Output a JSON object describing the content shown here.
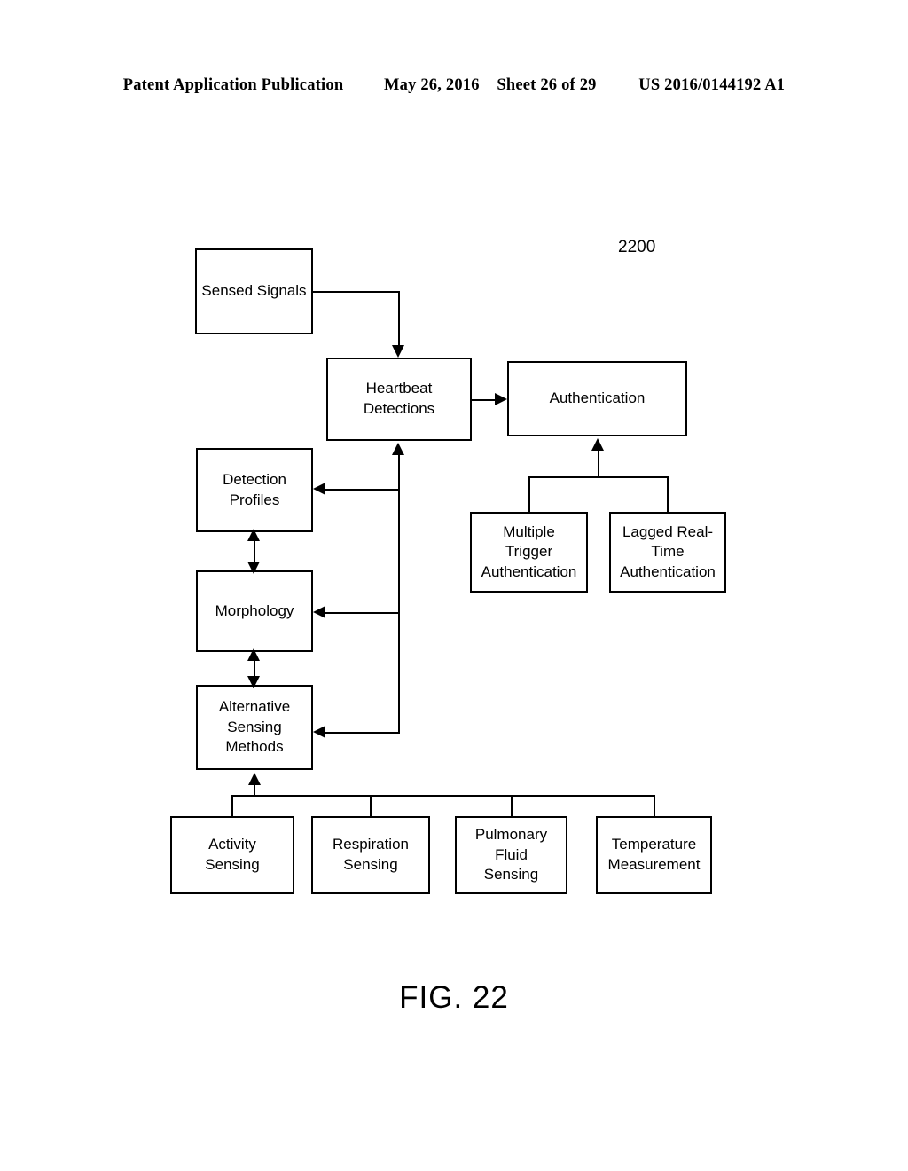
{
  "header": {
    "publication": "Patent Application Publication",
    "date": "May 26, 2016",
    "sheet": "Sheet 26 of 29",
    "patent_number": "US 2016/0144192 A1"
  },
  "figure": {
    "caption": "FIG. 22",
    "reference_numeral": "2200"
  },
  "diagram": {
    "nodes": {
      "sensed_signals": "Sensed Signals",
      "heartbeat_detections": "Heartbeat\nDetections",
      "authentication": "Authentication",
      "multiple_trigger_authentication": "Multiple\nTrigger\nAuthentication",
      "lagged_real_time_authentication": "Lagged Real-\nTime\nAuthentication",
      "detection_profiles": "Detection\nProfiles",
      "morphology": "Morphology",
      "alternative_sensing_methods": "Alternative\nSensing\nMethods",
      "activity_sensing": "Activity\nSensing",
      "respiration_sensing": "Respiration\nSensing",
      "pulmonary_fluid_sensing": "Pulmonary\nFluid\nSensing",
      "temperature_measurement": "Temperature\nMeasurement"
    },
    "colors": {
      "line": "#000000",
      "box_fill": "#ffffff",
      "text": "#000000"
    }
  }
}
